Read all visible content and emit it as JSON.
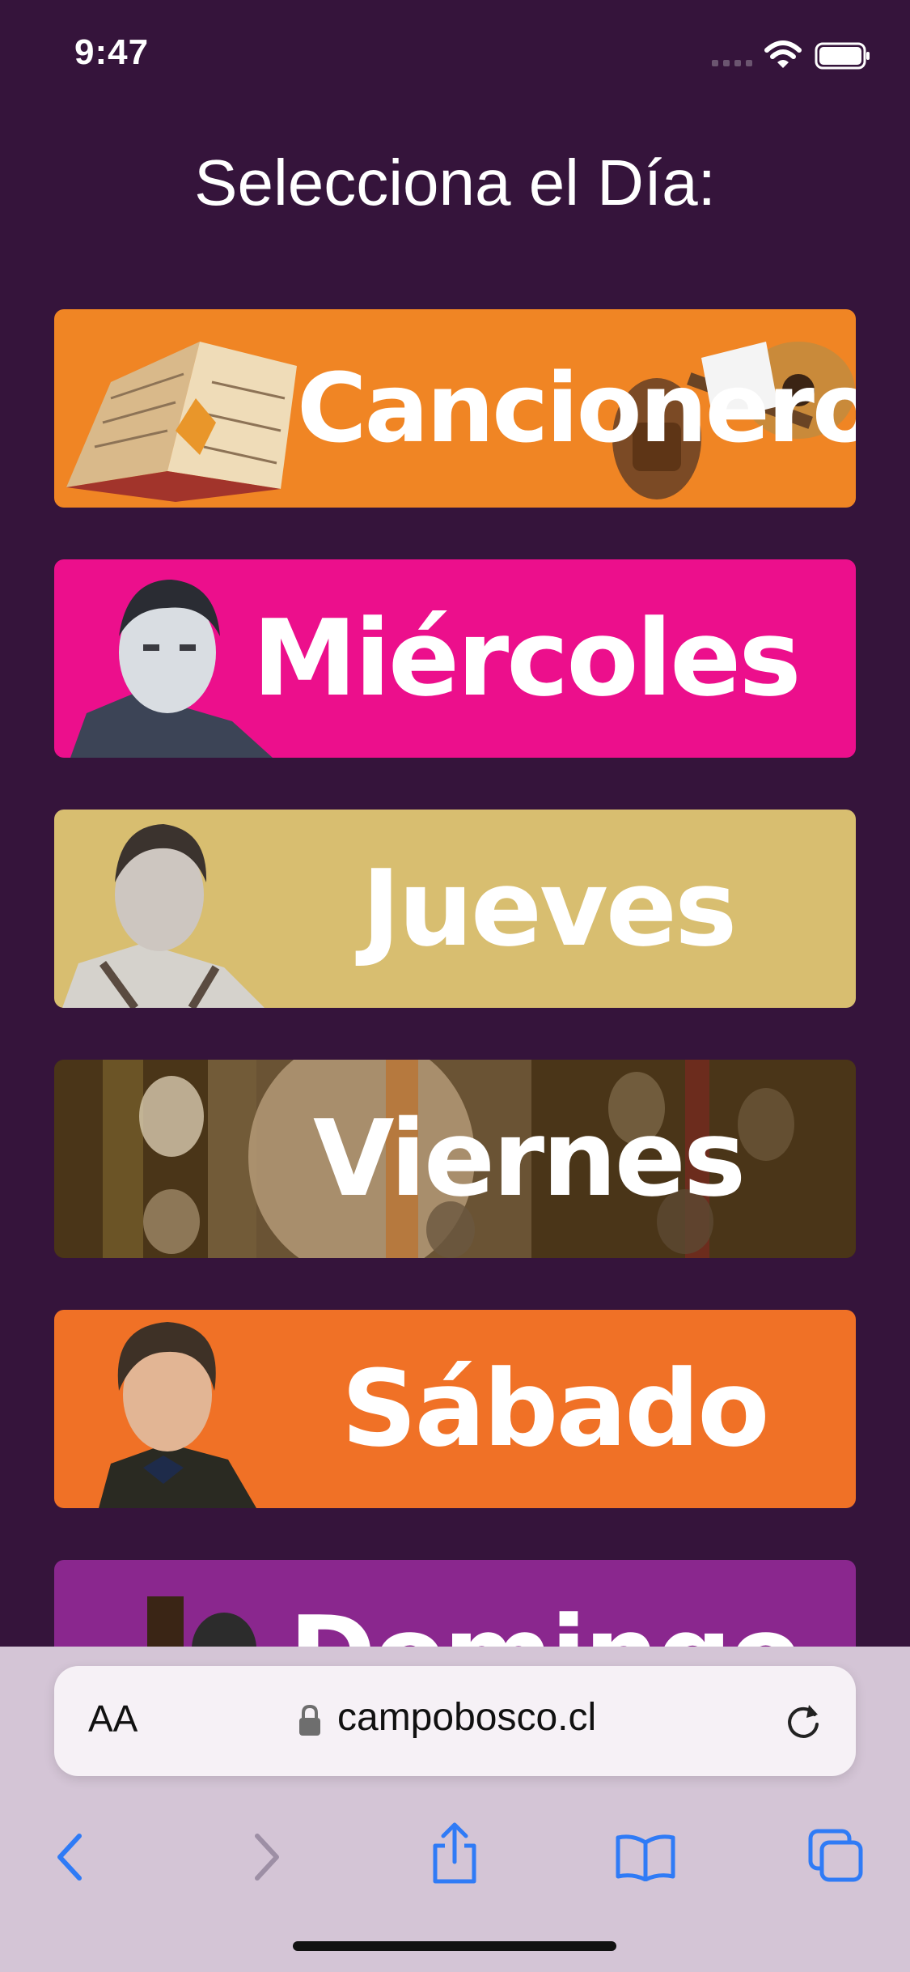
{
  "status": {
    "time": "9:47"
  },
  "page": {
    "title": "Selecciona el Día:"
  },
  "days": [
    {
      "label": "Cancionero",
      "color": "#f08524"
    },
    {
      "label": "Miércoles",
      "color": "#ec0f8c"
    },
    {
      "label": "Jueves",
      "color": "#d8be70"
    },
    {
      "label": "Viernes",
      "color": "#3d2c14"
    },
    {
      "label": "Sábado",
      "color": "#f07126"
    },
    {
      "label": "Domingo",
      "color": "#8a278e"
    }
  ],
  "browser": {
    "aa_label": "AA",
    "url": "campobosco.cl",
    "icons": [
      "lock-icon",
      "reload-icon",
      "back-icon",
      "forward-icon",
      "share-icon",
      "bookmarks-icon",
      "tabs-icon"
    ]
  }
}
